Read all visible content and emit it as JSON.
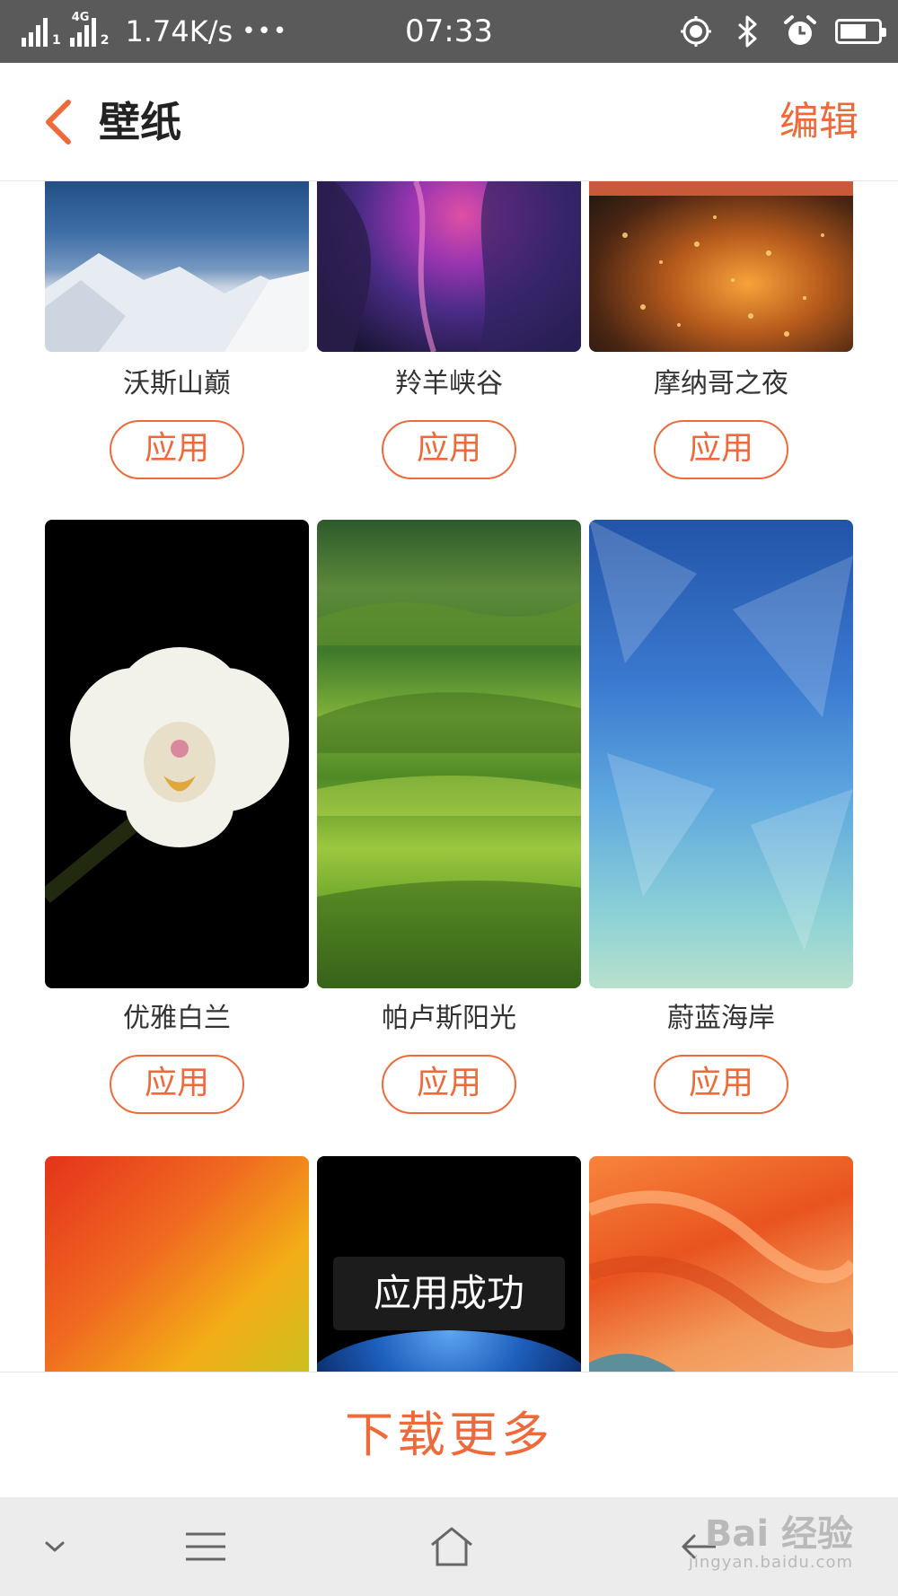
{
  "status_bar": {
    "net_speed": "1.74K/s",
    "dots": "•••",
    "sim1": "1",
    "sim2": "2",
    "network_type": "4G",
    "time": "07:33",
    "icons": [
      "signal-icon",
      "location-icon",
      "bluetooth-icon",
      "alarm-icon",
      "battery-icon"
    ],
    "battery_level": 0.6
  },
  "header": {
    "title": "壁纸",
    "edit_label": "编辑",
    "accent_color": "#ee6a3a"
  },
  "wallpapers": [
    {
      "name": "沃斯山巅",
      "apply_label": "应用"
    },
    {
      "name": "羚羊峡谷",
      "apply_label": "应用"
    },
    {
      "name": "摩纳哥之夜",
      "apply_label": "应用"
    },
    {
      "name": "优雅白兰",
      "apply_label": "应用"
    },
    {
      "name": "帕卢斯阳光",
      "apply_label": "应用"
    },
    {
      "name": "蔚蓝海岸",
      "apply_label": "应用"
    }
  ],
  "toast": {
    "text": "应用成功"
  },
  "download_more": "下载更多",
  "watermark": {
    "brand": "Bai 经验",
    "url": "jingyan.baidu.com"
  }
}
